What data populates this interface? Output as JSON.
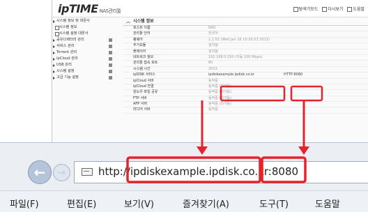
{
  "nas": {
    "logo": "ipTIME",
    "logo_suffix": "NAS관리툴",
    "header_links": [
      "탐색기모드",
      "다시보기",
      "도움말"
    ],
    "sidebar": [
      {
        "label": "시스템 정보 및 대몬사",
        "kind": "expanded"
      },
      {
        "label": "시스템 정보",
        "kind": "sub"
      },
      {
        "label": "시스템 설정 대몬사",
        "kind": "sub"
      },
      {
        "label": "공유디렉터리 관리",
        "kind": "item"
      },
      {
        "label": "서비스 관리",
        "kind": "item"
      },
      {
        "label": "Torrent 관리",
        "kind": "item"
      },
      {
        "label": "ipCloud 관리",
        "kind": "item"
      },
      {
        "label": "USB 관리",
        "kind": "item"
      },
      {
        "label": "시스템 설정",
        "kind": "item"
      },
      {
        "label": "고급 기능 설정",
        "kind": "item"
      }
    ],
    "main_title": "시스템 정보",
    "rows": [
      {
        "label": "호스트 이름",
        "value": "NAS"
      },
      {
        "label": "관리툴 언어",
        "value": "한국어"
      },
      {
        "label": "펌웨어",
        "value": "1.1.52 (Wed Jan 16 10:16:53 2013)"
      },
      {
        "label": "추가모듈",
        "value": "설치됨"
      },
      {
        "label": "플레이어",
        "value": "설치됨"
      },
      {
        "label": "네트워크 정보",
        "value": "192.168.0.250 (자동 100 Mbps)"
      },
      {
        "label": "관리툴 접속 포트",
        "value": "80"
      },
      {
        "label": "시스템 시간",
        "value": "2013"
      },
      {
        "label": "ipDISK 서비스",
        "value": "ipdiskexample.ipdisk.co.kr"
      },
      {
        "label": "ipCloud 서버",
        "value": "동작중"
      },
      {
        "label": "ipCloud 연결",
        "value": "동작중 (미가동)"
      },
      {
        "label": "윈도우 파일 공유",
        "value": "동작중 (미가동)"
      },
      {
        "label": "FTP 서버",
        "value": "동작중 (미가동)"
      },
      {
        "label": "AFP 서버",
        "value": "동작중 (미가동)"
      },
      {
        "label": "미디어 서버",
        "value": "동작중"
      }
    ],
    "ipdisk_port": "HTTP:8080"
  },
  "browser": {
    "url_prefix": "http://",
    "url_host": "ipdiskexample.ipdisk.co.kr",
    "url_port": ":8080",
    "menu": [
      "파일(F)",
      "편집(E)",
      "보기(V)",
      "즐겨찾기(A)",
      "도구(T)",
      "도움말"
    ]
  },
  "colors": {
    "annotation": "#e4242a"
  }
}
